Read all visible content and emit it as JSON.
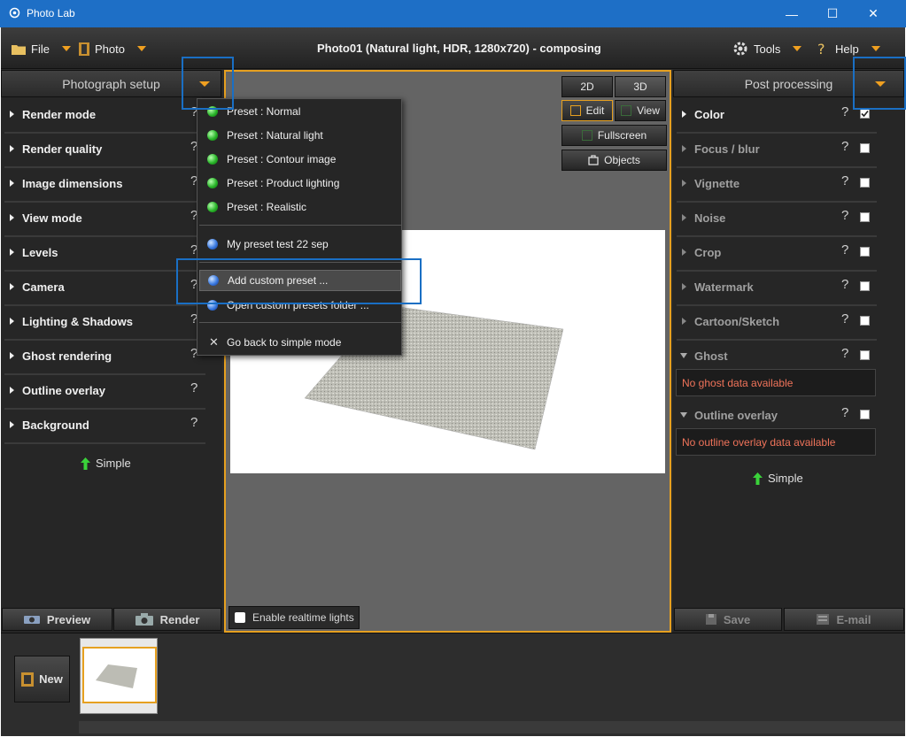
{
  "window": {
    "title": "Photo Lab",
    "minimize": "—",
    "maximize": "☐",
    "close": "✕"
  },
  "menubar": {
    "file": "File",
    "photo": "Photo",
    "tools": "Tools",
    "help": "Help",
    "document_title": "Photo01 (Natural light, HDR, 1280x720) - composing"
  },
  "left_panel": {
    "header": "Photograph setup",
    "sections": [
      {
        "label": "Render mode",
        "help": "?"
      },
      {
        "label": "Render quality",
        "help": "?"
      },
      {
        "label": "Image dimensions",
        "help": "?"
      },
      {
        "label": "View mode",
        "help": "?"
      },
      {
        "label": "Levels",
        "help": "?"
      },
      {
        "label": "Camera",
        "help": "?"
      },
      {
        "label": "Lighting & Shadows",
        "help": "?"
      },
      {
        "label": "Ghost rendering",
        "help": "?"
      },
      {
        "label": "Outline overlay",
        "help": "?"
      },
      {
        "label": "Background",
        "help": "?"
      }
    ],
    "simple": "Simple",
    "preview": "Preview",
    "render": "Render"
  },
  "dropdown": {
    "items": [
      {
        "label": "Preset : Normal",
        "dot": "green"
      },
      {
        "label": "Preset : Natural light",
        "dot": "green"
      },
      {
        "label": "Preset : Contour image",
        "dot": "green"
      },
      {
        "label": "Preset : Product lighting",
        "dot": "green"
      },
      {
        "label": "Preset : Realistic",
        "dot": "green"
      },
      {
        "label": "My preset test 22 sep",
        "dot": "blue"
      },
      {
        "label": "Add custom preset ...",
        "dot": "blue"
      },
      {
        "label": "Open custom presets folder ...",
        "dot": "blue"
      },
      {
        "label": "Go back to simple mode",
        "dot": "x"
      }
    ],
    "x_glyph": "✕"
  },
  "viewport": {
    "btn_2d": "2D",
    "btn_3d": "3D",
    "edit": "Edit",
    "view": "View",
    "fullscreen": "Fullscreen",
    "objects": "Objects",
    "realtime": "Enable realtime lights"
  },
  "right_panel": {
    "header": "Post processing",
    "sections": [
      {
        "label": "Color",
        "help": "?",
        "checked": true
      },
      {
        "label": "Focus / blur",
        "help": "?",
        "checked": false
      },
      {
        "label": "Vignette",
        "help": "?",
        "checked": false
      },
      {
        "label": "Noise",
        "help": "?",
        "checked": false
      },
      {
        "label": "Crop",
        "help": "?",
        "checked": false
      },
      {
        "label": "Watermark",
        "help": "?",
        "checked": false
      },
      {
        "label": "Cartoon/Sketch",
        "help": "?",
        "checked": false
      },
      {
        "label": "Ghost",
        "help": "?",
        "checked": false
      },
      {
        "label": "Outline overlay",
        "help": "?",
        "checked": false
      }
    ],
    "ghost_msg": "No ghost data available",
    "outline_msg": "No outline overlay data available",
    "simple": "Simple",
    "save": "Save",
    "email": "E-mail"
  },
  "filmstrip": {
    "new": "New"
  },
  "colors": {
    "accent": "#e6a020",
    "titlebar": "#1e6fc6",
    "annotation": "#1a6fc4",
    "warning_text": "#f0735a"
  }
}
